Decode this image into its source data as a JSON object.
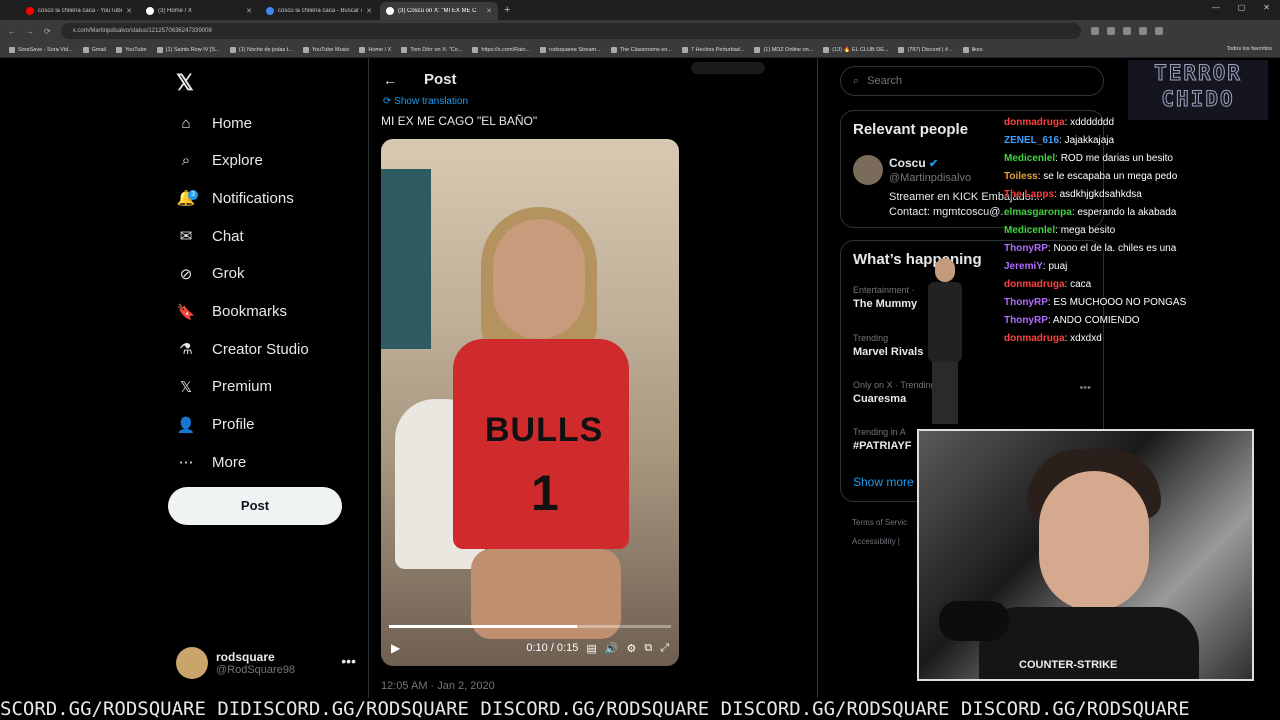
{
  "browser": {
    "tabs": [
      {
        "label": "cosco la chilena caca - YouTube",
        "color": "#ff0000"
      },
      {
        "label": "(3) Home / X",
        "color": "#ffffff"
      },
      {
        "label": "coscu la chilena caca - Buscar c",
        "color": "#4285f4"
      },
      {
        "label": "(3) Coscu on X: \"MI EX ME C",
        "color": "#ffffff"
      }
    ],
    "url": "x.com/Martinpdisalvo/status/1212570636247339008",
    "bookmarks": [
      "SoraSave - Sora Vid...",
      "Gmail",
      "YouTube",
      "(1) Saints Row IV [S...",
      "(1) Noche de jodas t...",
      "YouTube Music",
      "Home / X",
      "Tom Dörr on X: \"Co...",
      "https://x.com/Rain...",
      "rodsquaree Stream...",
      "The Classrooms en...",
      "7 Hechos Perturbad...",
      "(1) MDZ Online on...",
      "(13) 🔥 EL CLUB DE...",
      "(787) Discord | #...",
      "likes"
    ],
    "all_bookmarks": "Todos los favoritos"
  },
  "nav": {
    "items": [
      {
        "label": "Home",
        "icon": "home-icon"
      },
      {
        "label": "Explore",
        "icon": "search-icon"
      },
      {
        "label": "Notifications",
        "icon": "bell-icon",
        "badge": "3"
      },
      {
        "label": "Chat",
        "icon": "mail-icon"
      },
      {
        "label": "Grok",
        "icon": "grok-icon"
      },
      {
        "label": "Bookmarks",
        "icon": "bookmark-icon"
      },
      {
        "label": "Creator Studio",
        "icon": "flask-icon"
      },
      {
        "label": "Premium",
        "icon": "x-icon"
      },
      {
        "label": "Profile",
        "icon": "person-icon"
      },
      {
        "label": "More",
        "icon": "more-circle-icon"
      }
    ],
    "post_label": "Post",
    "account": {
      "name": "rodsquare",
      "handle": "@RodSquare98"
    }
  },
  "post": {
    "header": "Post",
    "show_translation": "Show translation",
    "text": "MI EX ME CAGO \"EL BAÑO\"",
    "video_time": "0:10 / 0:15",
    "video_progress": 0.667,
    "jersey_text": "BULLS",
    "jersey_number": "1",
    "timestamp": "12:05 AM · Jan 2, 2020"
  },
  "right": {
    "search_placeholder": "Search",
    "relevant_title": "Relevant people",
    "relevant": {
      "name": "Coscu",
      "handle": "@Martinpdisalvo",
      "bio1": "Streamer en KICK Embajador...",
      "bio2": "Contact: mgmtcoscu@..."
    },
    "happening_title": "What’s happening",
    "trends": [
      {
        "category": "Entertainment ·",
        "name": "The Mummy"
      },
      {
        "category": "Trending",
        "name": "Marvel Rivals"
      },
      {
        "category": "Only on X · Trending",
        "name": "Cuaresma"
      },
      {
        "category": "Trending in A",
        "name": "#PATRIAYF"
      }
    ],
    "show_more": "Show more",
    "footer1": "Terms of Servic",
    "footer2": "Accessibility |"
  },
  "overlay": {
    "logo_line1": "TERROR",
    "logo_line2": "CHIDO",
    "chat": [
      {
        "user": "donmadruga",
        "msg": "xddddddd",
        "color": "#ff4040"
      },
      {
        "user": "ZENEL_616",
        "msg": "Jajakkajaja",
        "color": "#3aa0ff"
      },
      {
        "user": "Medicenlel",
        "msg": "ROD me darias un besito",
        "color": "#3fd13f"
      },
      {
        "user": "Toiless",
        "msg": "se le escapaba un mega pedo",
        "color": "#e6a23c"
      },
      {
        "user": "The Lapps",
        "msg": "asdkhjgkdsahkdsa",
        "color": "#ff3b3b"
      },
      {
        "user": "elmasgaronpa",
        "msg": "esperando la akabada",
        "color": "#3fd13f"
      },
      {
        "user": "Medicenlel",
        "msg": "mega besito",
        "color": "#3fd13f"
      },
      {
        "user": "ThonyRP",
        "msg": "Nooo el de la. chiles es una",
        "color": "#b06cff"
      },
      {
        "user": "JeremiY",
        "msg": "puaj",
        "color": "#b06cff"
      },
      {
        "user": "donmadruga",
        "msg": "caca",
        "color": "#ff4040"
      },
      {
        "user": "ThonyRP",
        "msg": "ES MUCHOOO NO PONGAS",
        "color": "#b06cff"
      },
      {
        "user": "ThonyRP",
        "msg": "ANDO COMIENDO",
        "color": "#b06cff"
      },
      {
        "user": "donmadruga",
        "msg": "xdxdxd",
        "color": "#ff4040"
      }
    ],
    "shirt_text": "COUNTER-STRIKE",
    "ticker": "SCORD.GG/RODSQUARE DIDISCORD.GG/RODSQUARE DISCORD.GG/RODSQUARE DISCORD.GG/RODSQUARE DISCORD.GG/RODSQUARE"
  }
}
